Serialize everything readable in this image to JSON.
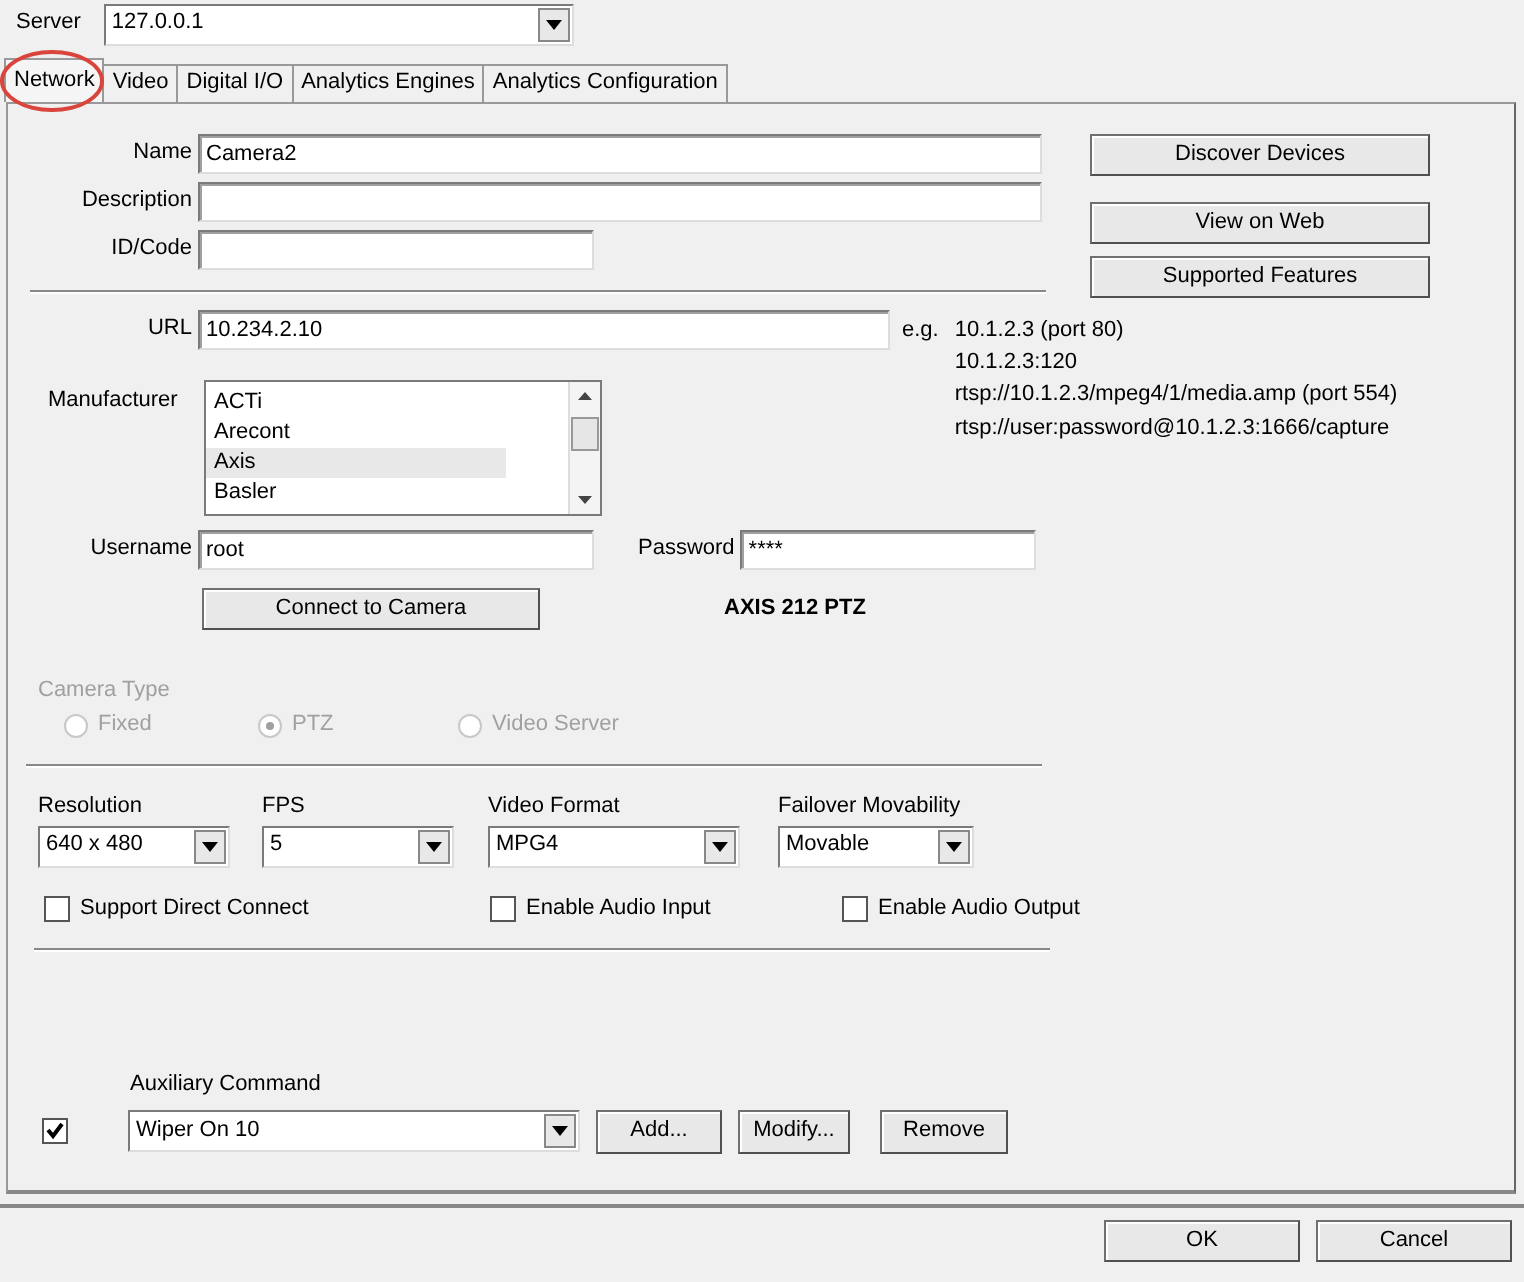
{
  "server": {
    "label": "Server",
    "value": "127.0.0.1"
  },
  "tabs": [
    {
      "label": "Network",
      "selected": true,
      "circled": true
    },
    {
      "label": "Video",
      "selected": false,
      "circled": false
    },
    {
      "label": "Digital I/O",
      "selected": false,
      "circled": false
    },
    {
      "label": "Analytics Engines",
      "selected": false,
      "circled": false
    },
    {
      "label": "Analytics Configuration",
      "selected": false,
      "circled": false
    }
  ],
  "name": {
    "label": "Name",
    "value": "Camera2"
  },
  "description": {
    "label": "Description"
  },
  "id_code": {
    "label": "ID/Code"
  },
  "side_buttons": [
    "Discover Devices",
    "View on Web",
    "Supported Features"
  ],
  "url": {
    "label": "URL",
    "value": "10.234.2.10",
    "hint_label": "e.g.",
    "examples": [
      "10.1.2.3 (port 80)",
      "10.1.2.3:120",
      "rtsp://10.1.2.3/mpeg4/1/media.amp (port 554)",
      "rtsp://user:password@10.1.2.3:1666/capture"
    ]
  },
  "manufacturer": {
    "label": "Manufacturer",
    "items": [
      {
        "label": "ACTi",
        "selected": false
      },
      {
        "label": "Arecont",
        "selected": false
      },
      {
        "label": "Axis",
        "selected": true
      },
      {
        "label": "Basler",
        "selected": false
      }
    ]
  },
  "username": {
    "label": "Username",
    "value": "root"
  },
  "password": {
    "label": "Password",
    "value": "****"
  },
  "connect_button": "Connect to Camera",
  "detected_model": "AXIS 212 PTZ",
  "camera_type": {
    "label": "Camera Type",
    "disabled": true,
    "options": [
      {
        "label": "Fixed",
        "selected": false
      },
      {
        "label": "PTZ",
        "selected": true
      },
      {
        "label": "Video Server",
        "selected": false
      }
    ]
  },
  "dropdowns": [
    {
      "label": "Resolution",
      "value": "640 x 480"
    },
    {
      "label": "FPS",
      "value": "5"
    },
    {
      "label": "Video Format",
      "value": "MPG4"
    },
    {
      "label": "Failover Movability",
      "value": "Movable"
    }
  ],
  "checkboxes": [
    {
      "label": "Support Direct Connect",
      "checked": false
    },
    {
      "label": "Enable Audio Input",
      "checked": false
    },
    {
      "label": "Enable Audio Output",
      "checked": false
    }
  ],
  "auxiliary": {
    "label": "Auxiliary Command",
    "enabled": true,
    "value": "Wiper On 10",
    "buttons": [
      "Add...",
      "Modify...",
      "Remove"
    ]
  },
  "footer_buttons": [
    "OK",
    "Cancel"
  ]
}
